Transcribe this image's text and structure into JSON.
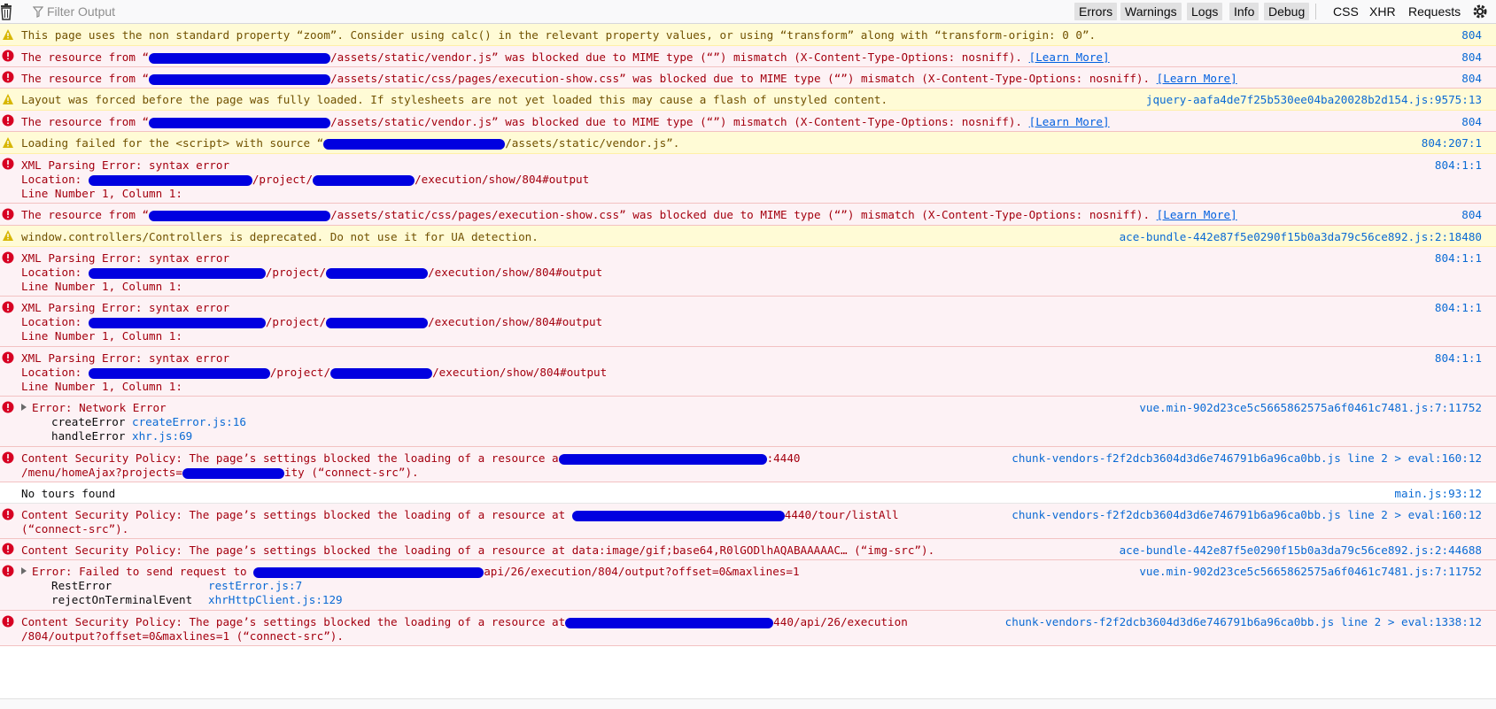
{
  "toolbar": {
    "filter_placeholder": "Filter Output",
    "buttons": [
      "Errors",
      "Warnings",
      "Logs",
      "Info",
      "Debug",
      "CSS",
      "XHR",
      "Requests"
    ]
  },
  "colors": {
    "error_bg": "#fdf2f5",
    "error_text": "#a4000f",
    "warn_bg": "#fffbd6",
    "warn_text": "#715100",
    "link": "#0a6ad4"
  },
  "messages": [
    {
      "type": "warn",
      "lines": [
        "This page uses the non standard property “zoom”. Consider using calc() in the relevant property values, or using “transform” along with “transform-origin: 0 0”."
      ],
      "source": "804"
    },
    {
      "type": "error",
      "pre": "The resource from “",
      "post": "/assets/static/vendor.js” was blocked due to MIME type (“”) mismatch (X-Content-Type-Options: nosniff). ",
      "link": "[Learn More]",
      "source": "804"
    },
    {
      "type": "error",
      "pre": "The resource from “",
      "post": "/assets/static/css/pages/execution-show.css” was blocked due to MIME type (“”) mismatch (X-Content-Type-Options: nosniff). ",
      "link": "[Learn More]",
      "source": "804"
    },
    {
      "type": "warn",
      "lines": [
        "Layout was forced before the page was fully loaded. If stylesheets are not yet loaded this may cause a flash of unstyled content."
      ],
      "source": "jquery-aafa4de7f25b530ee04ba20028b2d154.js:9575:13"
    },
    {
      "type": "error",
      "pre": "The resource from “",
      "post": "/assets/static/vendor.js” was blocked due to MIME type (“”) mismatch (X-Content-Type-Options: nosniff). ",
      "link": "[Learn More]",
      "source": "804"
    },
    {
      "type": "warn",
      "pre": "Loading failed for the <script> with source “",
      "post": "/assets/static/vendor.js”.",
      "source": "804:207:1"
    },
    {
      "type": "error",
      "xml": true,
      "line1": "XML Parsing Error: syntax error",
      "loc_pre": "Location: ",
      "loc_mid": "/project/",
      "loc_post": "/execution/show/804#output",
      "line3": "Line Number 1, Column 1:",
      "source": "804:1:1"
    },
    {
      "type": "error",
      "pre": "The resource from “",
      "post": "/assets/static/css/pages/execution-show.css” was blocked due to MIME type (“”) mismatch (X-Content-Type-Options: nosniff). ",
      "link": "[Learn More]",
      "source": "804"
    },
    {
      "type": "warn",
      "lines": [
        "window.controllers/Controllers is deprecated. Do not use it for UA detection."
      ],
      "source": "ace-bundle-442e87f5e0290f15b0a3da79c56ce892.js:2:18480"
    },
    {
      "type": "error",
      "xml": true,
      "line1": "XML Parsing Error: syntax error",
      "loc_pre": "Location: ",
      "loc_mid": "/project/",
      "loc_post": "/execution/show/804#output",
      "line3": "Line Number 1, Column 1:",
      "source": "804:1:1"
    },
    {
      "type": "error",
      "xml": true,
      "line1": "XML Parsing Error: syntax error",
      "loc_pre": "Location: ",
      "loc_mid": "/project/",
      "loc_post": "/execution/show/804#output",
      "line3": "Line Number 1, Column 1:",
      "source": "804:1:1"
    },
    {
      "type": "error",
      "xml": true,
      "line1": "XML Parsing Error: syntax error",
      "loc_pre": "Location: ",
      "loc_mid": "/project/",
      "loc_post": "/execution/show/804#output",
      "line3": "Line Number 1, Column 1:",
      "source": "804:1:1"
    },
    {
      "type": "error",
      "stack": true,
      "head": "Error: Network Error",
      "frames": [
        {
          "fn": "createError",
          "file": "createError.js:16"
        },
        {
          "fn": "handleError",
          "file": "xhr.js:69"
        }
      ],
      "source": "vue.min-902d23ce5c5665862575a6f0461c7481.js:7:11752"
    },
    {
      "type": "error",
      "csp2": true,
      "l1pre": "Content Security Policy: The page’s settings blocked the loading of a resource a",
      "l1post": ":4440",
      "l2pre": "/menu/homeAjax?projects=",
      "l2post": "ity (“connect-src”).",
      "source": "chunk-vendors-f2f2dcb3604d3d6e746791b6a96ca0bb.js line 2 > eval:160:12"
    },
    {
      "type": "log",
      "lines": [
        "No tours found"
      ],
      "source": "main.js:93:12"
    },
    {
      "type": "error",
      "csp3": true,
      "l1pre": "Content Security Policy: The page’s settings blocked the loading of a resource at ",
      "l1post": "4440/tour/listAll",
      "l2": "(“connect-src”).",
      "source": "chunk-vendors-f2f2dcb3604d3d6e746791b6a96ca0bb.js line 2 > eval:160:12"
    },
    {
      "type": "error",
      "lines": [
        "Content Security Policy: The page’s settings blocked the loading of a resource at data:image/gif;base64,R0lGODlhAQABAAAAAC… (“img-src”)."
      ],
      "source": "ace-bundle-442e87f5e0290f15b0a3da79c56ce892.js:2:44688"
    },
    {
      "type": "error",
      "stack2": true,
      "head_pre": "Error: Failed to send request to ",
      "head_post": "api/26/execution/804/output?offset=0&maxlines=1",
      "frames": [
        {
          "fn": "RestError",
          "file": "restError.js:7"
        },
        {
          "fn": "rejectOnTerminalEvent",
          "file": "xhrHttpClient.js:129"
        }
      ],
      "source": "vue.min-902d23ce5c5665862575a6f0461c7481.js:7:11752"
    },
    {
      "type": "error",
      "csp3b": true,
      "l1pre": "Content Security Policy: The page’s settings blocked the loading of a resource at",
      "l1post": "440/api/26/execution",
      "l2": "/804/output?offset=0&maxlines=1 (“connect-src”).",
      "source": "chunk-vendors-f2f2dcb3604d3d6e746791b6a96ca0bb.js line 2 > eval:1338:12"
    }
  ]
}
